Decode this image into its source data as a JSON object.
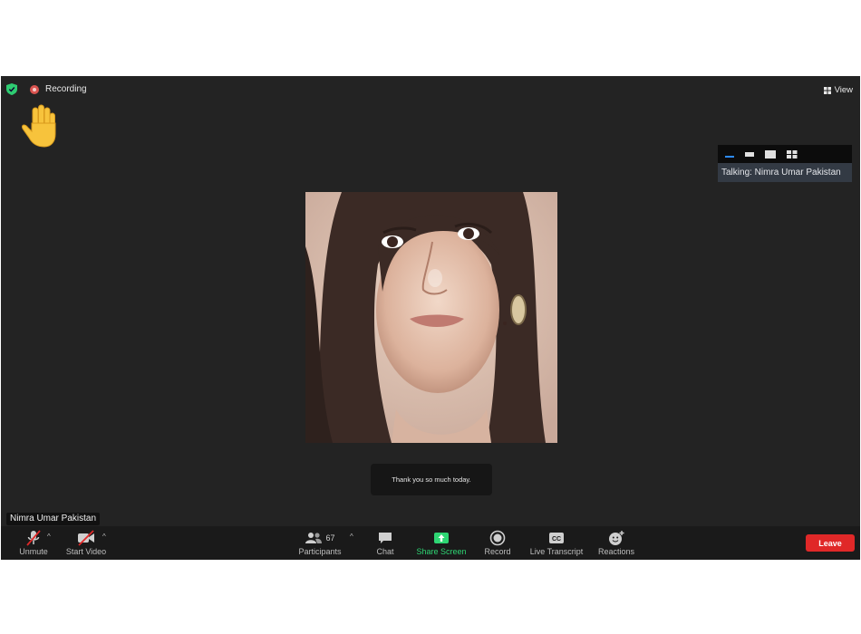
{
  "recording": {
    "label": "Recording"
  },
  "view": {
    "label": "View"
  },
  "talking": {
    "label": "Talking: Nimra Umar Pakistan"
  },
  "video": {
    "participant_name": "Nimra Umar Pakistan"
  },
  "caption": {
    "text": "Thank you so much today."
  },
  "toolbar": {
    "unmute": "Unmute",
    "start_video": "Start Video",
    "participants": "Participants",
    "participants_count": "67",
    "chat": "Chat",
    "share_screen": "Share Screen",
    "record": "Record",
    "live_transcript": "Live Transcript",
    "reactions": "Reactions",
    "leave": "Leave"
  },
  "icons": {
    "security": "shield-icon",
    "recording": "recording-dot-icon",
    "raise_hand": "raised-hand-icon",
    "view": "grid-icon",
    "cc_label": "CC"
  },
  "colors": {
    "window_bg": "#232323",
    "toolbar_bg": "#1a1a1a",
    "leave": "#e02828",
    "share_screen": "#2ed573",
    "security": "#2ecc71",
    "recording": "#d9534f"
  }
}
